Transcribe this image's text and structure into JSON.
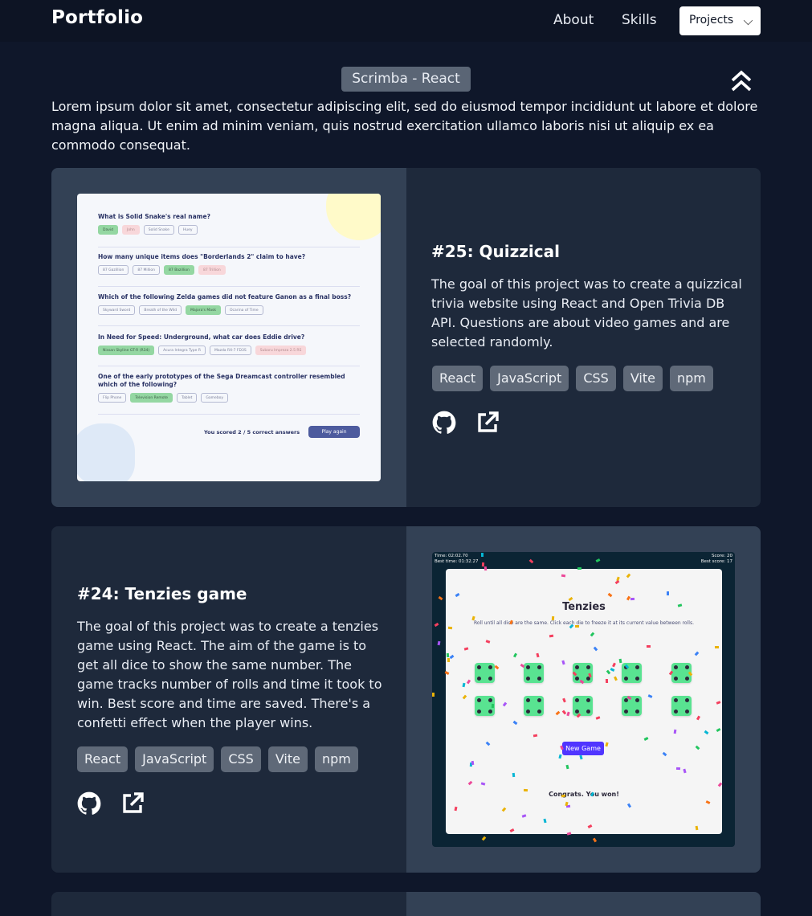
{
  "nav": {
    "brand": "Portfolio",
    "links": [
      "About",
      "Skills"
    ],
    "select_value": "Projects"
  },
  "section": {
    "badge": "Scrimba - React",
    "intro": "Lorem ipsum dolor sit amet, consectetur adipiscing elit, sed do eiusmod tempor incididunt ut labore et dolore magna aliqua. Ut enim ad minim veniam, quis nostrud exercitation ullamco laboris nisi ut aliquip ex ea commodo consequat."
  },
  "projects": [
    {
      "title": "#25: Quizzical",
      "description": "The goal of this project was to create a quizzical trivia website using React and Open Trivia DB API. Questions are about video games and are selected randomly.",
      "tags": [
        "React",
        "JavaScript",
        "CSS",
        "Vite",
        "npm"
      ],
      "links": [
        "github-icon",
        "external-link-icon"
      ],
      "screenshot": {
        "questions": [
          {
            "q": "What is Solid Snake's real name?",
            "answers": [
              "David",
              "John",
              "Solid Snake",
              "Huey"
            ]
          },
          {
            "q": "How many unique items does \"Borderlands 2\" claim to have?",
            "answers": [
              "87 Gazillion",
              "87 Million",
              "87 Bazillion",
              "87 Trillion"
            ]
          },
          {
            "q": "Which of the following Zelda games did not feature Ganon as a final boss?",
            "answers": [
              "Skyward Sword",
              "Breath of the Wild",
              "Majora's Mask",
              "Ocarina of Time"
            ]
          },
          {
            "q": "In Need for Speed: Underground, what car does Eddie drive?",
            "answers": [
              "Nissan Skyline GT-R (R34)",
              "Acura Integra Type R",
              "Mazda RX-7 FD3S",
              "Subaru Impreza 2.5 RS"
            ]
          },
          {
            "q": "One of the early prototypes of the Sega Dreamcast controller resembled which of the following?",
            "answers": [
              "Flip Phone",
              "Television Remote",
              "Tablet",
              "Gameboy"
            ]
          }
        ],
        "score_text": "You scored 2 / 5 correct answers",
        "play_again": "Play again"
      }
    },
    {
      "title": "#24: Tenzies game",
      "description": "The goal of this project was to create a tenzies game using React. The aim of the game is to get all dice to show the same number. The game tracks number of rolls and time it took to win. Best score and time are saved. There's a confetti effect when the player wins.",
      "tags": [
        "React",
        "JavaScript",
        "CSS",
        "Vite",
        "npm"
      ],
      "links": [
        "github-icon",
        "external-link-icon"
      ],
      "screenshot": {
        "time": "Time: 02:02.70",
        "best_time": "Best time: 01:32.27",
        "score": "Score: 20",
        "best_score": "Best score: 17",
        "title": "Tenzies",
        "instructions": "Roll until all dice are the same. Click each die to freeze it at its current value between rolls.",
        "new_game": "New Game",
        "congrats": "Congrats. You won!"
      }
    }
  ],
  "colors": {
    "page_bg": "#0f172a",
    "card_light": "#334155",
    "card_dark": "#1e293b",
    "tag_bg": "#5f6978"
  }
}
